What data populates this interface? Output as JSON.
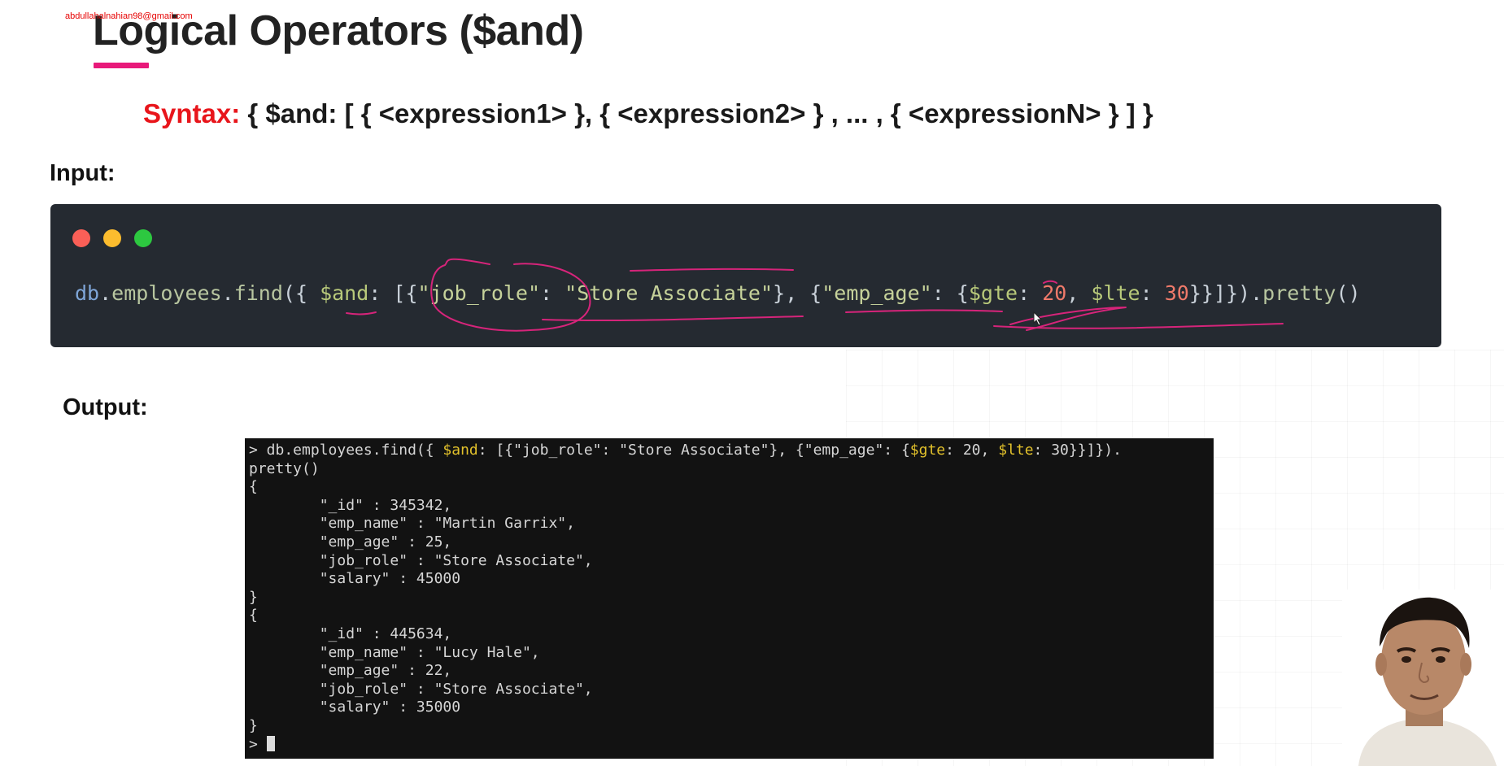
{
  "watermark": "abdullahalnahian98@gmail.com",
  "slide": {
    "title": "Logical Operators ($and)",
    "syntax_label": "Syntax:",
    "syntax_body": "{ $and: [ { <expression1> }, { <expression2> } , ... , { <expressionN> } ] }",
    "input_label": "Input:",
    "output_label": "Output:"
  },
  "code_window": {
    "tokens": {
      "db": "db",
      "dot1": ".",
      "collection": "employees",
      "dot2": ".",
      "find": "find",
      "open": "({ ",
      "and_op": "$and",
      "after_and": ": [{",
      "key1": "\"job_role\"",
      "colon1": ": ",
      "val1": "\"Store Associate\"",
      "mid": "}, {",
      "key2": "\"emp_age\"",
      "colon2": ": {",
      "gte": "$gte",
      "colon3": ": ",
      "num1": "20",
      "comma": ", ",
      "lte": "$lte",
      "colon4": ": ",
      "num2": "30",
      "close": "}}]})",
      "dot3": ".",
      "pretty": "pretty",
      "parens": "()"
    },
    "colors": {
      "background": "#252a31",
      "dot_red": "#fa5f57",
      "dot_yellow": "#fcbc2e",
      "dot_green": "#2dc840",
      "annotation": "#d6247a"
    }
  },
  "terminal": {
    "cmd_prefix": "> db.employees.find({ ",
    "cmd_and": "$and",
    "cmd_mid": ": [{\"job_role\": \"Store Associate\"}, {\"emp_age\": {",
    "cmd_gte": "$gte",
    "cmd_mid2": ": 20, ",
    "cmd_lte": "$lte",
    "cmd_end": ": 30}}]}).",
    "cmd_wrap": "pretty()",
    "lines": [
      "{",
      "        \"_id\" : 345342,",
      "        \"emp_name\" : \"Martin Garrix\",",
      "        \"emp_age\" : 25,",
      "        \"job_role\" : \"Store Associate\",",
      "        \"salary\" : 45000",
      "}",
      "{",
      "        \"_id\" : 445634,",
      "        \"emp_name\" : \"Lucy Hale\",",
      "        \"emp_age\" : 22,",
      "        \"job_role\" : \"Store Associate\",",
      "        \"salary\" : 35000",
      "}"
    ],
    "prompt": "> "
  },
  "colors": {
    "title_underline": "#e8197a",
    "syntax_label": "#e8151b",
    "terminal_bg": "#121212",
    "terminal_highlight": "#e2c12b"
  }
}
